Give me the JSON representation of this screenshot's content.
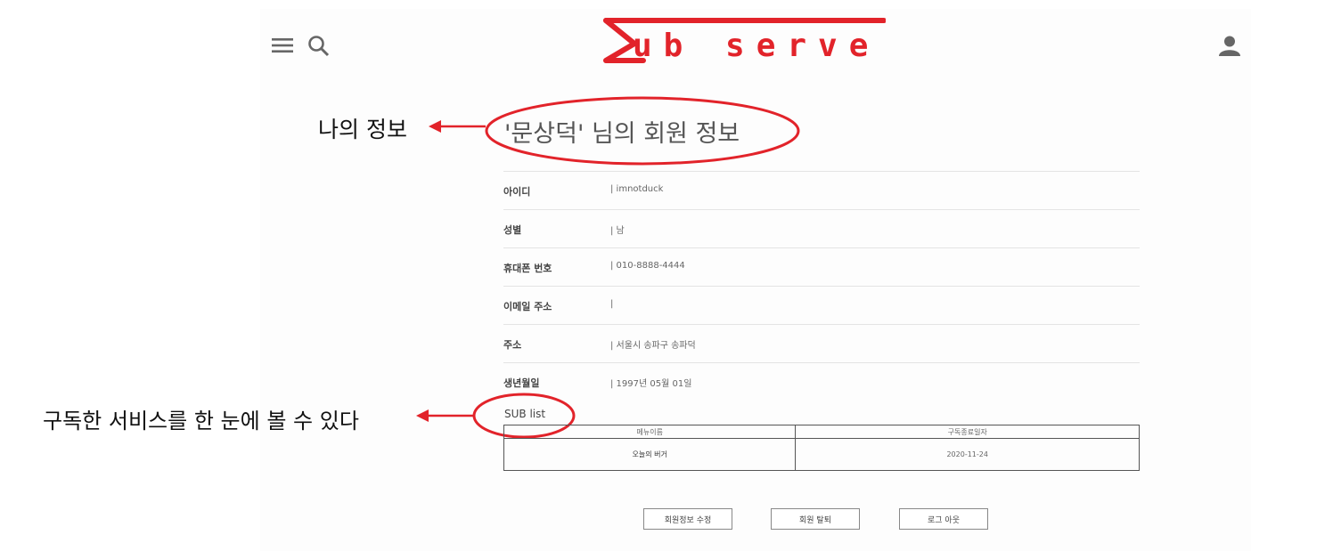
{
  "header": {
    "logo_text": "ub serve",
    "menu_icon": "hamburger-menu-icon",
    "search_icon": "search-icon",
    "user_icon": "user-icon"
  },
  "annotations": {
    "my_info": "나의 정보",
    "sub_list_note": "구독한 서비스를 한 눈에 볼 수 있다",
    "color": "#e2232a"
  },
  "page_title": "'문상덕' 님의 회원 정보",
  "fields": [
    {
      "label": "아이디",
      "value": "|  imnotduck"
    },
    {
      "label": "성별",
      "value": "|  남"
    },
    {
      "label": "휴대폰 번호",
      "value": "|  010-8888-4444"
    },
    {
      "label": "이메일 주소",
      "value": "|"
    },
    {
      "label": "주소",
      "value": "|  서울시 송파구 송파덕"
    },
    {
      "label": "생년월일",
      "value": "|  1997년 05월 01일"
    }
  ],
  "sub_list": {
    "title": "SUB list",
    "columns": [
      "메뉴이름",
      "구독종료일자"
    ],
    "rows": [
      [
        "오늘의 버거",
        "2020-11-24"
      ]
    ]
  },
  "buttons": {
    "edit": "회원정보 수정",
    "withdraw": "회원 탈퇴",
    "logout": "로그 아웃"
  }
}
